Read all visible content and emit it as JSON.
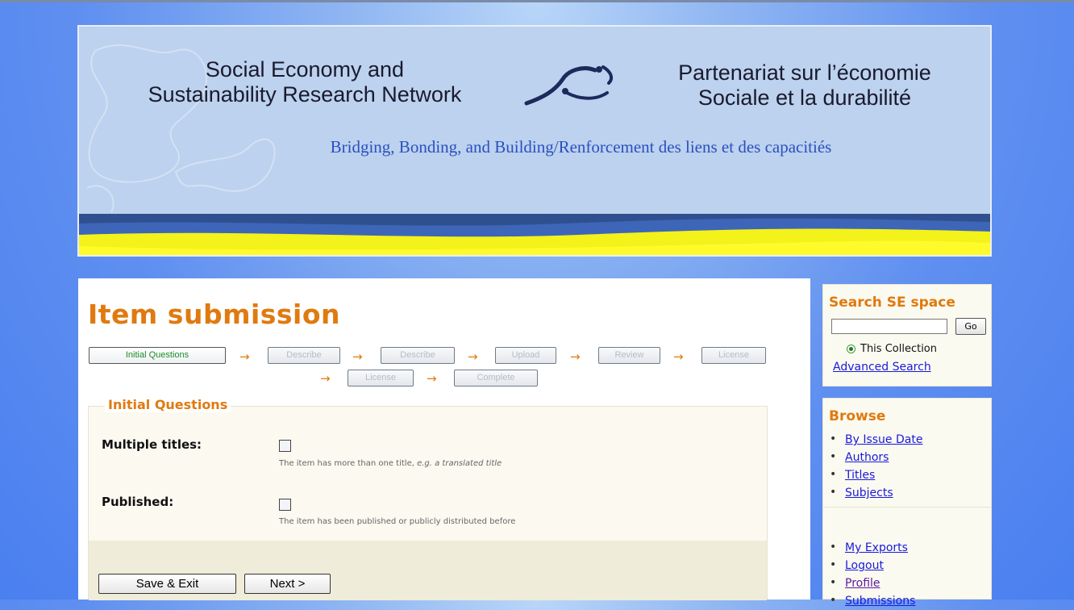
{
  "banner": {
    "title_en_line1": "Social Economy and",
    "title_en_line2": "Sustainability Research Network",
    "title_fr_line1": "Partenariat sur l’économie",
    "title_fr_line2": "Sociale et la durabilité",
    "tagline": "Bridging, Bonding, and Building/Renforcement des liens et des capacitiés"
  },
  "page": {
    "title": "Item submission"
  },
  "steps": [
    {
      "label": "Initial Questions"
    },
    {
      "label": "Describe"
    },
    {
      "label": "Describe"
    },
    {
      "label": "Upload"
    },
    {
      "label": "Review"
    },
    {
      "label": "License"
    },
    {
      "label": "License"
    },
    {
      "label": "Complete"
    }
  ],
  "form": {
    "legend": "Initial Questions",
    "multiple_titles": {
      "label": "Multiple titles:",
      "help": "The item has more than one title, ",
      "help_example": "e.g. a translated title"
    },
    "published": {
      "label": "Published:",
      "help": "The item has been published or publicly distributed before"
    },
    "save_exit": "Save & Exit",
    "next": "Next >"
  },
  "sidebar": {
    "search": {
      "title": "Search SE space",
      "go": "Go",
      "scope": "This Collection",
      "advanced": "Advanced Search"
    },
    "browse": {
      "title": "Browse",
      "items": [
        {
          "label": "By Issue Date"
        },
        {
          "label": "Authors"
        },
        {
          "label": "Titles"
        },
        {
          "label": "Subjects"
        }
      ]
    },
    "account": {
      "items": [
        {
          "label": "My Exports"
        },
        {
          "label": "Logout"
        },
        {
          "label": "Profile"
        },
        {
          "label": "Submissions"
        }
      ]
    }
  },
  "colors": {
    "accent": "#e07a10",
    "link": "#1a1adb",
    "active_step": "#1a8d2a"
  }
}
